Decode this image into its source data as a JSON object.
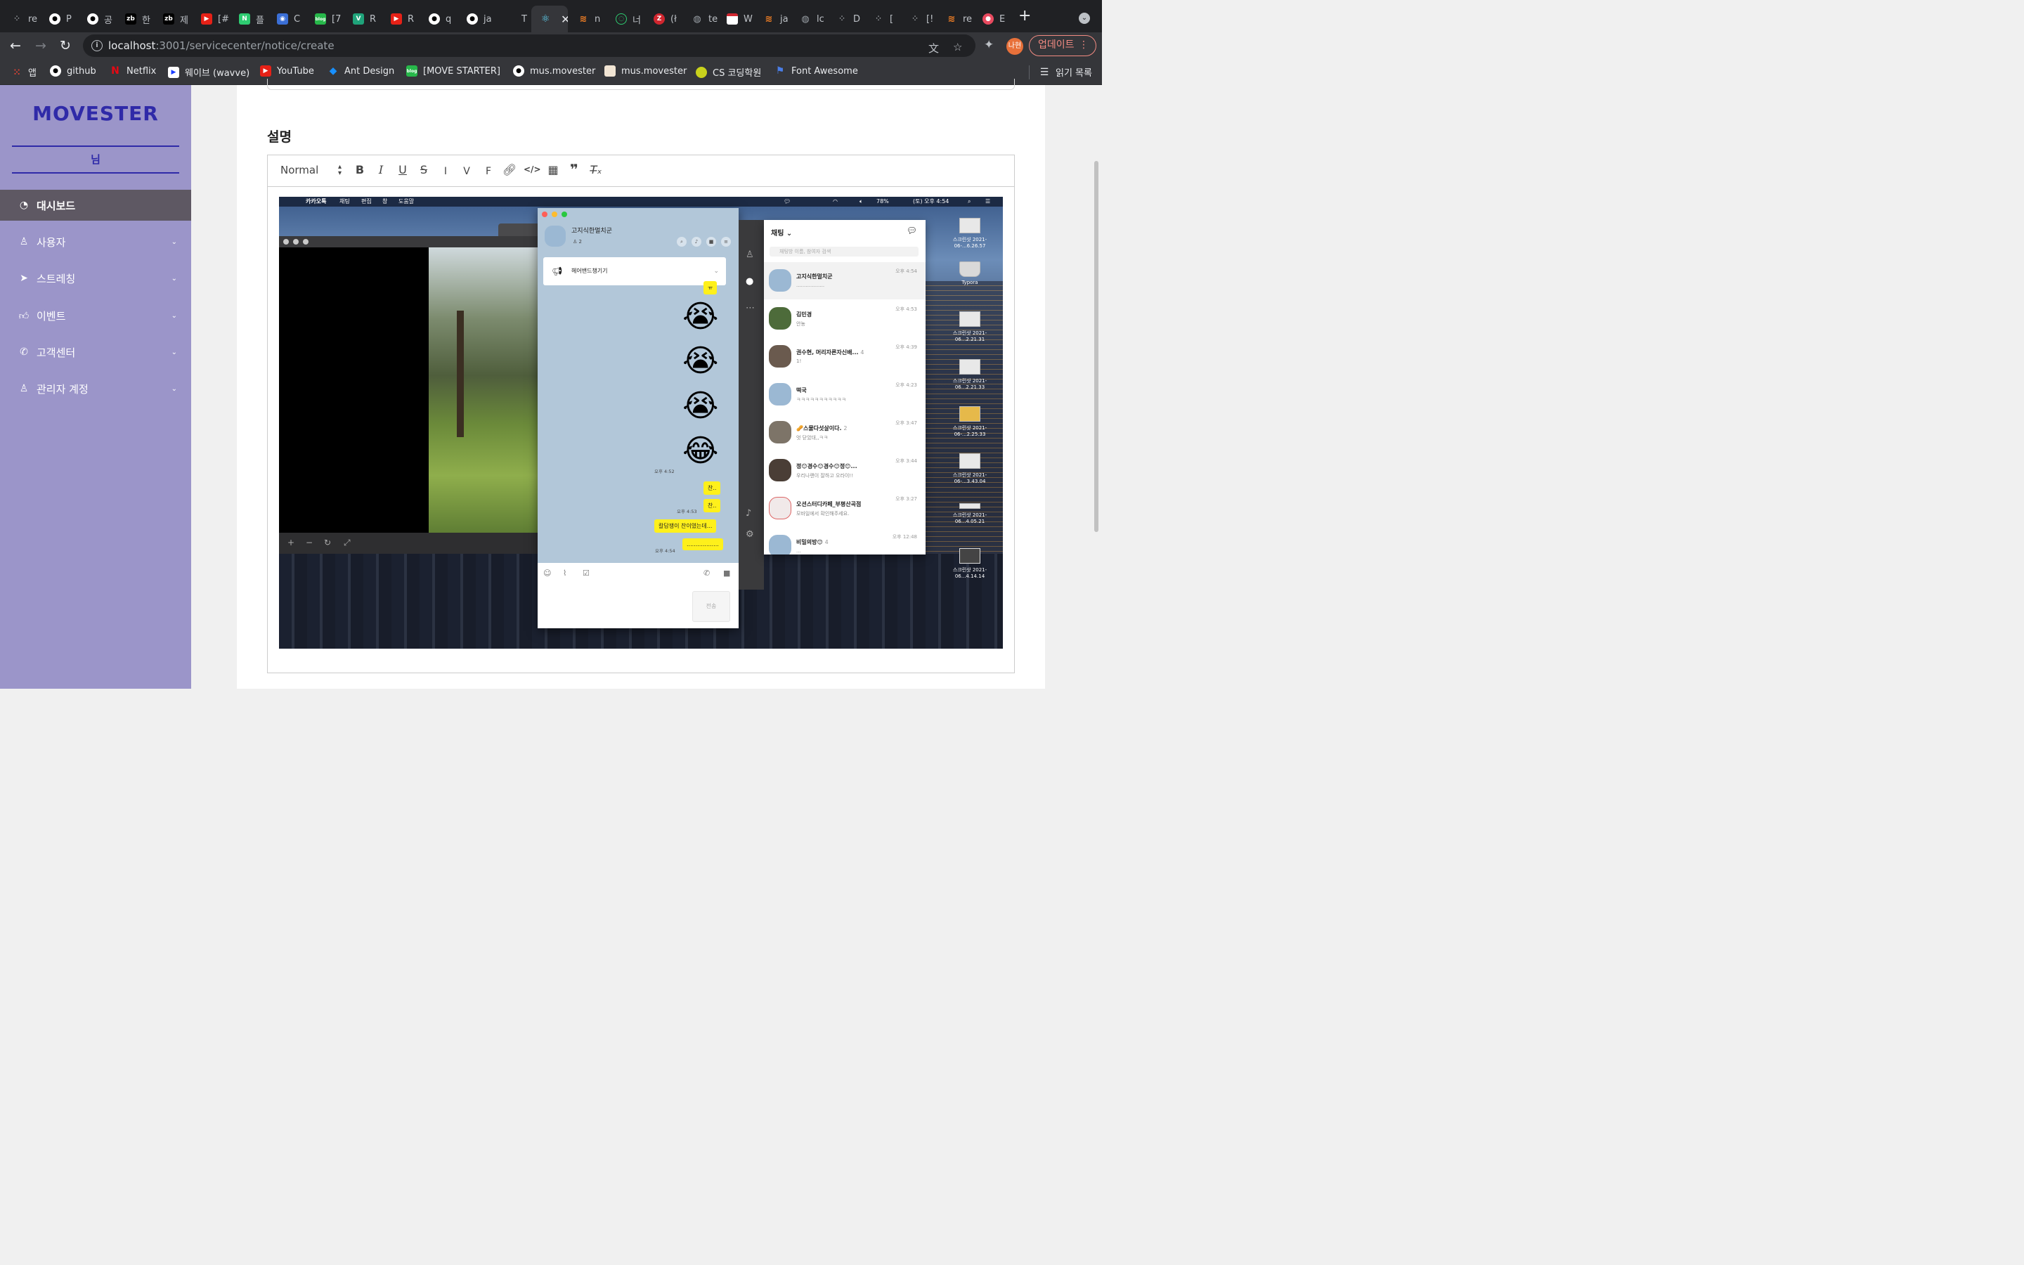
{
  "browser": {
    "tabs": [
      {
        "label": "re",
        "icon": "github-icon"
      },
      {
        "label": "P",
        "icon": "github-icon"
      },
      {
        "label": "공",
        "icon": "github-icon"
      },
      {
        "label": "한",
        "icon": "zb-icon"
      },
      {
        "label": "제",
        "icon": "zb-icon"
      },
      {
        "label": "[#",
        "icon": "youtube-icon"
      },
      {
        "label": "플",
        "icon": "notion-icon"
      },
      {
        "label": "C",
        "icon": "app-icon"
      },
      {
        "label": "[7",
        "icon": "blog-icon"
      },
      {
        "label": "R",
        "icon": "v-icon"
      },
      {
        "label": "R",
        "icon": "youtube-icon"
      },
      {
        "label": "q",
        "icon": "github-icon"
      },
      {
        "label": "ja",
        "icon": "github-icon"
      },
      {
        "label": "T",
        "icon": "blank-icon"
      },
      {
        "label": "",
        "icon": "react-icon"
      },
      {
        "label": "n",
        "icon": "stackoverflow-icon"
      },
      {
        "label": "너",
        "icon": "chat-icon"
      },
      {
        "label": "(ł",
        "icon": "z-icon"
      },
      {
        "label": "te",
        "icon": "globe-icon"
      },
      {
        "label": "W",
        "icon": "mail-icon"
      },
      {
        "label": "ja",
        "icon": "stackoverflow-icon"
      },
      {
        "label": "lc",
        "icon": "globe-icon"
      },
      {
        "label": "D",
        "icon": "dots-icon"
      },
      {
        "label": "[",
        "icon": "dots-icon"
      },
      {
        "label": "[!",
        "icon": "dots-icon"
      },
      {
        "label": "re",
        "icon": "stackoverflow-icon"
      },
      {
        "label": "E",
        "icon": "app-icon"
      }
    ],
    "url_host": "localhost",
    "url_path": ":3001/servicecenter/notice/create",
    "profile_initial": "나현",
    "update_label": "업데이트",
    "bookmarks": [
      {
        "label": "앱",
        "icon": "apps-icon"
      },
      {
        "label": "github",
        "icon": "github-icon"
      },
      {
        "label": "Netflix",
        "icon": "netflix-icon"
      },
      {
        "label": "웨이브 (wavve)",
        "icon": "wavve-icon"
      },
      {
        "label": "YouTube",
        "icon": "youtube-icon"
      },
      {
        "label": "Ant Design",
        "icon": "antd-icon"
      },
      {
        "label": "[MOVE STARTER]",
        "icon": "blog-icon"
      },
      {
        "label": "mus.movester",
        "icon": "github-icon"
      },
      {
        "label": "mus.movester",
        "icon": "page-icon"
      },
      {
        "label": "CS 코딩학원",
        "icon": "ball-icon"
      },
      {
        "label": "Font Awesome",
        "icon": "flag-icon"
      }
    ],
    "reading_list": "읽기 목록"
  },
  "sidebar": {
    "logo": "MOVESTER",
    "user": "님",
    "items": [
      {
        "label": "대시보드",
        "icon": "dashboard-icon",
        "active": true
      },
      {
        "label": "사용자",
        "icon": "user-icon"
      },
      {
        "label": "스트레칭",
        "icon": "cursor-icon"
      },
      {
        "label": "이벤트",
        "icon": "thumbs-up-icon"
      },
      {
        "label": "고객센터",
        "icon": "whatsapp-icon"
      },
      {
        "label": "관리자 계정",
        "icon": "user-icon"
      }
    ]
  },
  "form": {
    "section_title": "설명",
    "format_select": "Normal",
    "toolbar": [
      "B",
      "I",
      "U",
      "S",
      "I",
      "V",
      "F",
      "link",
      "code",
      "video",
      "quote",
      "clear"
    ]
  },
  "embed": {
    "menubar": {
      "app": "카카오톡",
      "menus": [
        "채팅",
        "편집",
        "창",
        "도움말"
      ],
      "battery": "78%",
      "datetime": "(토) 오후 4:54"
    },
    "chat": {
      "title": "고지식한멀치군",
      "members": "2",
      "notice": "헤어밴드챙기기",
      "bubble_small": "ㅠ",
      "emojis": [
        "😭",
        "😭",
        "😭",
        "😂"
      ],
      "time1": "오후 4:52",
      "msg1": "찬..",
      "msg2": "찬..",
      "time2": "오후 4:53",
      "msg3": "칼답쟁이 찬이였는데...",
      "msg4": "..................",
      "time3": "오후 4:54",
      "send_label": "전송"
    },
    "list": {
      "title": "채팅",
      "search_placeholder": "채팅방 이름, 참여자 검색",
      "items": [
        {
          "name": "고지식한멀치군",
          "msg": "..................",
          "time": "오후 4:54"
        },
        {
          "name": "김민경",
          "msg": "안뇽",
          "time": "오후 4:53"
        },
        {
          "name": "권수현, 머리자른자신배...",
          "count": "4",
          "msg": "1!",
          "time": "오후 4:39"
        },
        {
          "name": "떡국",
          "msg": "ㅋㅋㅋㅋㅋㅋㅋㅋㅋㅋㅋ",
          "time": "오후 4:23"
        },
        {
          "name": "🥜스물다섯살이다.",
          "count": "2",
          "msg": "엇 닫았대,,ㅋㅋ",
          "time": "오후 3:47"
        },
        {
          "name": "정😊경수😊경수😊정😊...",
          "msg": "우리나랜이 잘하고 오라이!!",
          "time": "오후 3:44"
        },
        {
          "name": "오션스터디카페_부평산곡점",
          "msg": "모바일에서 확인해주세요.",
          "time": "오후 3:27"
        },
        {
          "name": "비밀의방😊",
          "count": "4",
          "msg": "...",
          "time": "오후 12:48"
        }
      ]
    },
    "desktop_icons": [
      {
        "label": "스크린샷 2021-06-...6.26.57"
      },
      {
        "label": "Typora"
      },
      {
        "label": "스크린샷 2021-06...2.21.31"
      },
      {
        "label": "스크린샷 2021-06...2.21.33"
      },
      {
        "label": "스크린샷 2021-06-...2.25.33"
      },
      {
        "label": "스크린샷 2021-06-...3.43.04"
      },
      {
        "label": "스크린샷 2021-06...4.05.21"
      },
      {
        "label": "스크린샷 2021-06...4.14.14"
      }
    ]
  }
}
